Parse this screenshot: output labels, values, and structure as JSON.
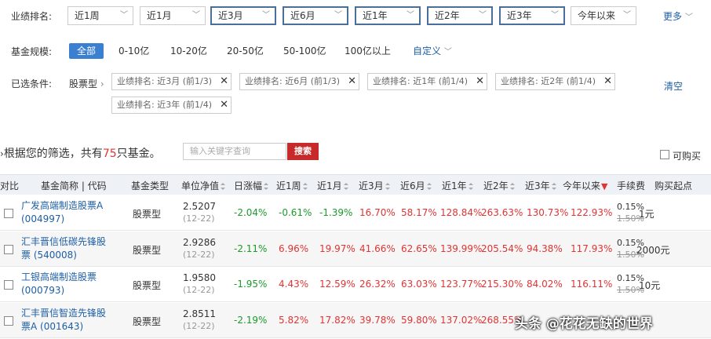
{
  "rank": {
    "label": "业绩排名:",
    "options": [
      "近1周",
      "近1月",
      "近3月",
      "近6月",
      "近1年",
      "近2年",
      "近3年",
      "今年以来"
    ],
    "more": "更多"
  },
  "size": {
    "label": "基金规模:",
    "options": [
      "全部",
      "0-10亿",
      "10-20亿",
      "20-50亿",
      "50-100亿",
      "100亿以上"
    ],
    "custom": "自定义"
  },
  "selected": {
    "label": "已选条件:",
    "fund_type": "股票型",
    "tags": [
      "业绩排名: 近3月 (前1/3)",
      "业绩排名: 近6月 (前1/3)",
      "业绩排名: 近1年 (前1/4)",
      "业绩排名: 近2年 (前1/4)",
      "业绩排名: 近3年 (前1/4)"
    ],
    "clear": "清空"
  },
  "result": {
    "prefix": "根据您的筛选，共有",
    "count": "75",
    "suffix": "只基金。",
    "search_placeholder": "输入关键字查询",
    "search_btn": "搜索",
    "buyable": "可购买"
  },
  "table": {
    "headers": [
      "对比",
      "基金简称 | 代码",
      "基金类型",
      "单位净值",
      "日涨幅",
      "近1周",
      "近1月",
      "近3月",
      "近6月",
      "近1年",
      "近2年",
      "近3年",
      "今年以来",
      "手续费",
      "购买起点"
    ],
    "rows": [
      {
        "name": "广发高端制造股票A",
        "code": "(004997)",
        "type": "股票型",
        "nav": "2.5207",
        "date": "(12-22)",
        "day": "-2.04%",
        "w1": "-0.61%",
        "m1": "-1.39%",
        "m3": "16.70%",
        "m6": "58.17%",
        "y1": "128.84%",
        "y2": "263.63%",
        "y3": "130.73%",
        "ytd": "122.93%",
        "fee": "0.15%",
        "fee_old": "1.50%",
        "start": "1元"
      },
      {
        "name": "汇丰晋信低碳先锋股",
        "code": "票 (540008)",
        "type": "股票型",
        "nav": "2.9286",
        "date": "(12-22)",
        "day": "-2.11%",
        "w1": "6.96%",
        "m1": "19.97%",
        "m3": "41.66%",
        "m6": "62.65%",
        "y1": "139.99%",
        "y2": "205.54%",
        "y3": "94.38%",
        "ytd": "117.93%",
        "fee": "0.15%",
        "fee_old": "1.50%",
        "start": "2000元"
      },
      {
        "name": "工银高端制造股票",
        "code": "(000793)",
        "type": "股票型",
        "nav": "1.9580",
        "date": "(12-22)",
        "day": "-1.95%",
        "w1": "4.43%",
        "m1": "12.59%",
        "m3": "26.32%",
        "m6": "63.03%",
        "y1": "123.77%",
        "y2": "215.30%",
        "y3": "84.02%",
        "ytd": "116.11%",
        "fee": "0.15%",
        "fee_old": "1.50%",
        "start": "10元"
      },
      {
        "name": "汇丰晋信智造先锋股",
        "code": "票A (001643)",
        "type": "股票型",
        "nav": "2.8511",
        "date": "(12-22)",
        "day": "-2.19%",
        "w1": "5.82%",
        "m1": "17.82%",
        "m3": "39.78%",
        "m6": "59.80%",
        "y1": "137.02%",
        "y2": "268.55%",
        "y3": "",
        "ytd": "",
        "fee": "",
        "fee_old": "",
        "start": ""
      }
    ]
  },
  "watermark": "头条 @花花无缺的世界"
}
